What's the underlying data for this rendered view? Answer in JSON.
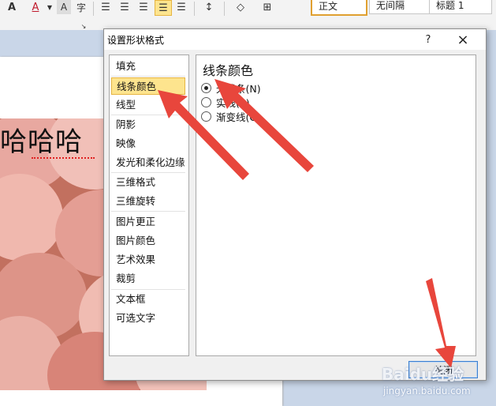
{
  "ribbon": {
    "style_normal": "正文",
    "style_nospace": "无间隔",
    "style_heading": "标题 1"
  },
  "document": {
    "text": "哈哈哈"
  },
  "dialog": {
    "title": "设置形状格式",
    "help": "?",
    "close_x": "×",
    "nav": [
      {
        "label": "填充"
      },
      {
        "label": "线条颜色"
      },
      {
        "label": "线型"
      },
      {
        "label": "阴影"
      },
      {
        "label": "映像"
      },
      {
        "label": "发光和柔化边缘"
      },
      {
        "label": "三维格式"
      },
      {
        "label": "三维旋转"
      },
      {
        "label": "图片更正"
      },
      {
        "label": "图片颜色"
      },
      {
        "label": "艺术效果"
      },
      {
        "label": "裁剪"
      },
      {
        "label": "文本框"
      },
      {
        "label": "可选文字"
      }
    ],
    "selected_nav": "线条颜色",
    "section_title": "线条颜色",
    "options": [
      {
        "label": "无线条(N)",
        "checked": true
      },
      {
        "label": "实线(S)",
        "checked": false
      },
      {
        "label": "渐变线(G)",
        "checked": false
      }
    ],
    "close_button": "关闭"
  },
  "watermark": {
    "brand": "Baidu经验",
    "url": "jingyan.baidu.com"
  },
  "colors": {
    "selected_bg": "#fde48e",
    "arrow": "#e8463c",
    "button_border": "#3c7fcf"
  }
}
